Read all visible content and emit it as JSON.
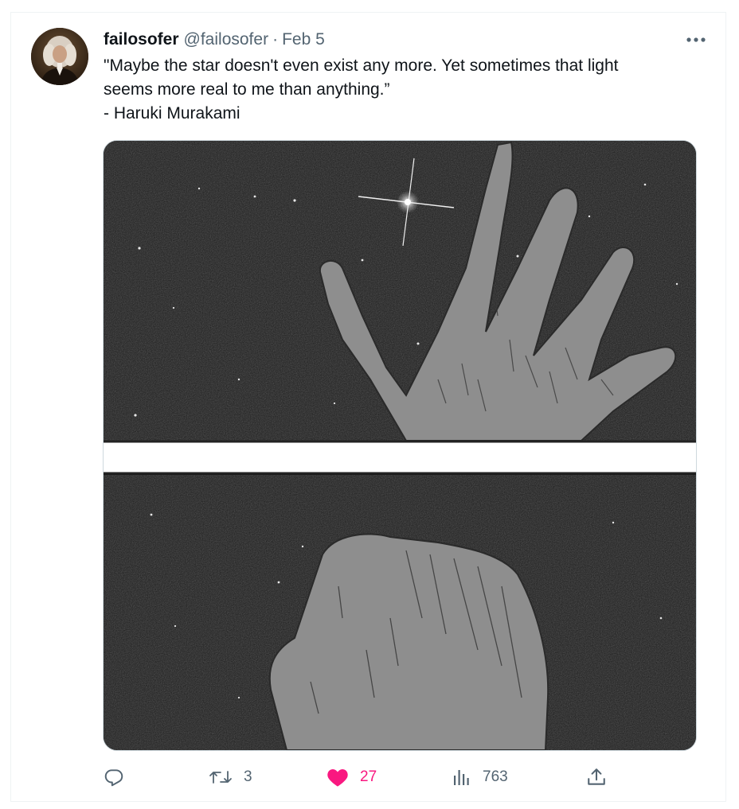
{
  "tweet": {
    "author_name": "failosofer",
    "author_handle": "@failosofer",
    "separator": "·",
    "timestamp": "Feb 5",
    "text_lines": [
      "\"Maybe the star doesn't even exist any more. Yet sometimes that light",
      "seems more real to me than anything.”",
      "- Haruki Murakami"
    ]
  },
  "actions": {
    "reply_count": "",
    "retweet_count": "3",
    "like_count": "27",
    "views_count": "763"
  },
  "icons": {
    "more": "more-dots-icon",
    "reply": "reply-icon",
    "retweet": "retweet-icon",
    "like": "heart-icon",
    "views": "views-icon",
    "share": "share-icon"
  },
  "colors": {
    "like_active": "#f91880",
    "secondary_text": "#536471",
    "border": "#eff3f4"
  }
}
